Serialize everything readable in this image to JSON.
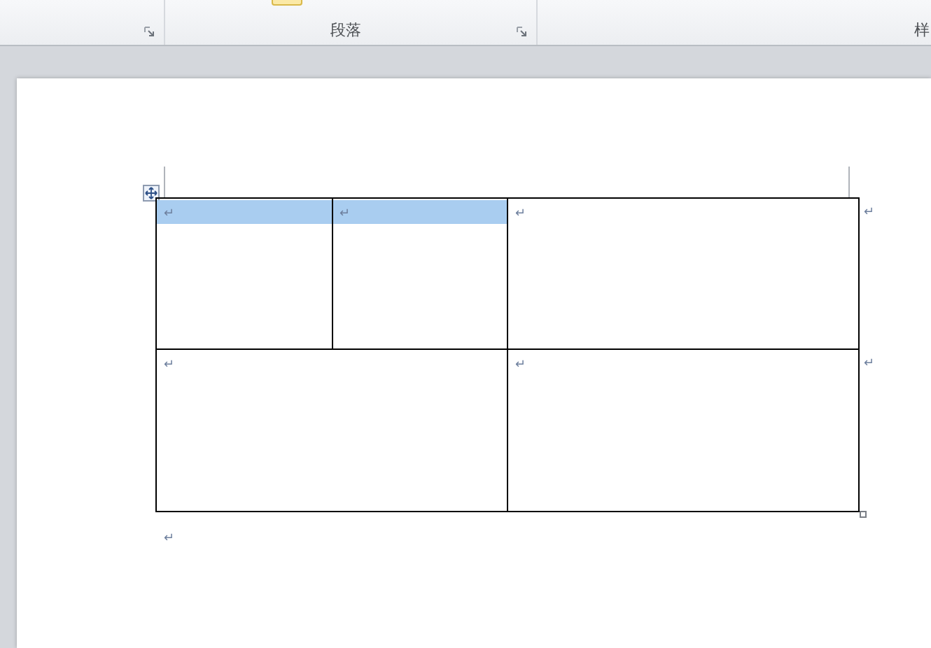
{
  "ribbon": {
    "groups": [
      {
        "kind": "unlabeled",
        "launcher": true
      },
      {
        "kind": "labeled",
        "label": "段落",
        "launcher": true
      },
      {
        "kind": "labeled",
        "label": "样",
        "launcher": false
      }
    ]
  },
  "table": {
    "cells": [
      {
        "mark": "↵",
        "selected": true
      },
      {
        "mark": "↵",
        "selected": true
      },
      {
        "mark": "↵",
        "selected": false
      },
      {
        "mark": "↵",
        "selected": false
      },
      {
        "mark": "↵",
        "selected": false
      }
    ],
    "row_end_marks": [
      "↵",
      "↵"
    ]
  },
  "after_table_mark": "↵"
}
